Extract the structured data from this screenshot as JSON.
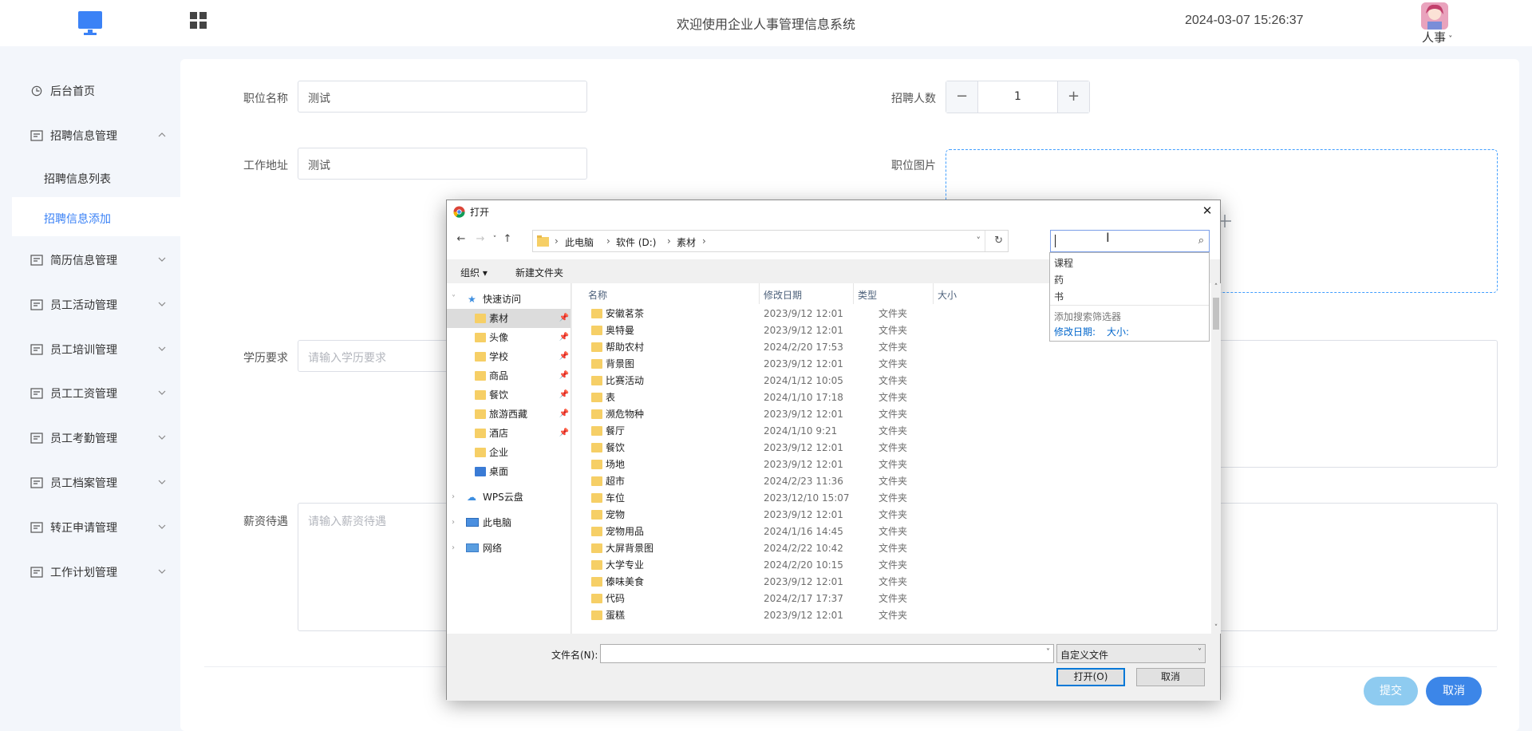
{
  "header": {
    "title": "欢迎使用企业人事管理信息系统",
    "datetime": "2024-03-07 15:26:37",
    "role": "人事"
  },
  "sidebar": {
    "items": [
      {
        "label": "后台首页"
      },
      {
        "label": "招聘信息管理"
      },
      {
        "label": "简历信息管理"
      },
      {
        "label": "员工活动管理"
      },
      {
        "label": "员工培训管理"
      },
      {
        "label": "员工工资管理"
      },
      {
        "label": "员工考勤管理"
      },
      {
        "label": "员工档案管理"
      },
      {
        "label": "转正申请管理"
      },
      {
        "label": "工作计划管理"
      }
    ],
    "subitems": [
      {
        "label": "招聘信息列表"
      },
      {
        "label": "招聘信息添加"
      }
    ]
  },
  "form": {
    "position_label": "职位名称",
    "position_value": "测试",
    "count_label": "招聘人数",
    "count_value": "1",
    "stepper_minus": "−",
    "stepper_plus": "+",
    "address_label": "工作地址",
    "address_value": "测试",
    "image_label": "职位图片",
    "education_label": "学历要求",
    "education_placeholder": "请输入学历要求",
    "salary_label": "薪资待遇",
    "salary_placeholder": "请输入薪资待遇",
    "submit": "提交",
    "cancel": "取消"
  },
  "dialog": {
    "title": "打开",
    "close": "✕",
    "breadcrumb": [
      "此电脑",
      "软件 (D:)",
      "素材"
    ],
    "organize": "组织 ▾",
    "new_folder": "新建文件夹",
    "columns": {
      "name": "名称",
      "date": "修改日期",
      "type": "类型",
      "size": "大小"
    },
    "nav": {
      "quick_access": "快速访问",
      "quick_items": [
        "素材",
        "头像",
        "学校",
        "商品",
        "餐饮",
        "旅游西藏",
        "酒店",
        "企业",
        "桌面"
      ],
      "wps": "WPS云盘",
      "pc": "此电脑",
      "network": "网络"
    },
    "files": [
      {
        "name": "安徽茗茶",
        "date": "2023/9/12 12:01",
        "type": "文件夹"
      },
      {
        "name": "奥特曼",
        "date": "2023/9/12 12:01",
        "type": "文件夹"
      },
      {
        "name": "帮助农村",
        "date": "2024/2/20 17:53",
        "type": "文件夹"
      },
      {
        "name": "背景图",
        "date": "2023/9/12 12:01",
        "type": "文件夹"
      },
      {
        "name": "比赛活动",
        "date": "2024/1/12 10:05",
        "type": "文件夹"
      },
      {
        "name": "表",
        "date": "2024/1/10 17:18",
        "type": "文件夹"
      },
      {
        "name": "濒危物种",
        "date": "2023/9/12 12:01",
        "type": "文件夹"
      },
      {
        "name": "餐厅",
        "date": "2024/1/10 9:21",
        "type": "文件夹"
      },
      {
        "name": "餐饮",
        "date": "2023/9/12 12:01",
        "type": "文件夹"
      },
      {
        "name": "场地",
        "date": "2023/9/12 12:01",
        "type": "文件夹"
      },
      {
        "name": "超市",
        "date": "2024/2/23 11:36",
        "type": "文件夹"
      },
      {
        "name": "车位",
        "date": "2023/12/10 15:07",
        "type": "文件夹"
      },
      {
        "name": "宠物",
        "date": "2023/9/12 12:01",
        "type": "文件夹"
      },
      {
        "name": "宠物用品",
        "date": "2024/1/16 14:45",
        "type": "文件夹"
      },
      {
        "name": "大屏背景图",
        "date": "2024/2/22 10:42",
        "type": "文件夹"
      },
      {
        "name": "大学专业",
        "date": "2024/2/20 10:15",
        "type": "文件夹"
      },
      {
        "name": "傣味美食",
        "date": "2023/9/12 12:01",
        "type": "文件夹"
      },
      {
        "name": "代码",
        "date": "2024/2/17 17:37",
        "type": "文件夹"
      },
      {
        "name": "蛋糕",
        "date": "2023/9/12 12:01",
        "type": "文件夹"
      }
    ],
    "filename_label": "文件名(N):",
    "filetype": "自定义文件",
    "open": "打开(O)",
    "cancel": "取消",
    "search_suggestions": [
      "课程",
      "药",
      "书"
    ],
    "search_filter_hint": "添加搜索筛选器",
    "filter_date": "修改日期:",
    "filter_size": "大小:"
  },
  "colors": {
    "accent": "#3b82f6",
    "folder": "#f6cf66",
    "submit": "#8ecbf0",
    "cancel": "#3c86e8"
  }
}
